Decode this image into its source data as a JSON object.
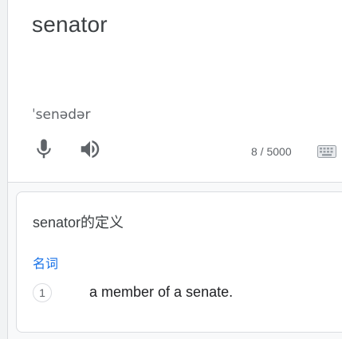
{
  "source": {
    "word": "senator",
    "phonetic": "ˈsenədər",
    "char_count": "8 / 5000"
  },
  "icons": {
    "mic": "microphone-icon",
    "speaker": "speaker-icon",
    "keyboard": "keyboard-icon"
  },
  "definitions": {
    "title": "senator的定义",
    "part_of_speech": "名词",
    "items": [
      {
        "number": "1",
        "text": "a member of a senate."
      }
    ]
  },
  "colors": {
    "accent": "#1a73e8",
    "icon": "#5f6368",
    "text": "#202124",
    "border": "#dadce0"
  }
}
